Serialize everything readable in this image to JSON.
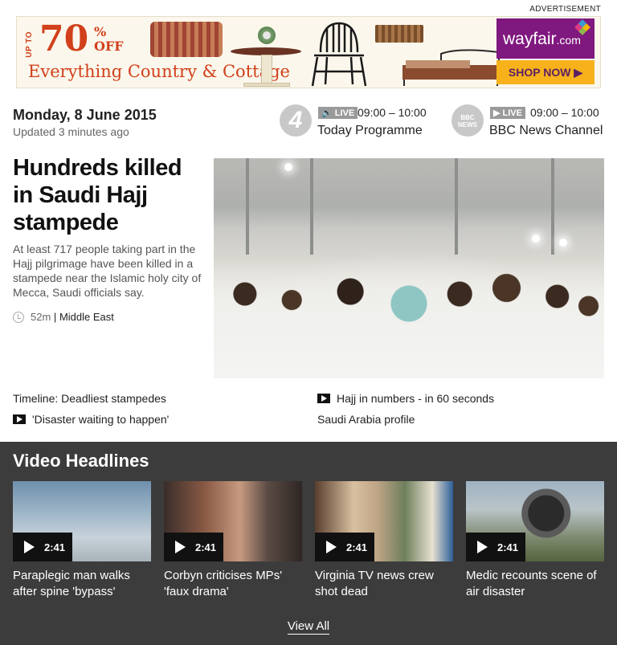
{
  "advertisement": {
    "label": "ADVERTISEMENT",
    "up_to": "UP TO",
    "percent": "70",
    "pct_sign": "%",
    "off": "OFF",
    "tagline": "Everything Country & Cottage",
    "brand": "wayfair",
    "brand_suffix": ".com",
    "cta": "SHOP NOW ▶"
  },
  "header": {
    "date": "Monday, 8 June 2015",
    "updated": "Updated 3 minutes ago"
  },
  "programmes": [
    {
      "logo": "4",
      "live": "LIVE",
      "time": "09:00 – 10:00",
      "name": "Today Programme",
      "icon": "speaker-icon"
    },
    {
      "logo": "BBC NEWS",
      "live": "LIVE",
      "time": "09:00 – 10:00",
      "name": "BBC News Channel",
      "icon": "play-icon"
    }
  ],
  "lead": {
    "headline": "Hundreds killed in Saudi Hajj stampede",
    "summary": "At least 717 people taking part in the Hajj pilgrimage have been killed in a stampede near the Islamic holy city of Mecca, Saudi officials say.",
    "age": "52m",
    "separator": "|",
    "section": "Middle East"
  },
  "related": [
    {
      "label": "Timeline: Deadliest stampedes",
      "video": false
    },
    {
      "label": "Hajj in numbers - in 60 seconds",
      "video": true
    },
    {
      "label": "'Disaster waiting to happen'",
      "video": true
    },
    {
      "label": "Saudi Arabia profile",
      "video": false
    }
  ],
  "video_headlines": {
    "title": "Video Headlines",
    "items": [
      {
        "duration": "2:41",
        "caption": "Paraplegic man walks after spine 'bypass'"
      },
      {
        "duration": "2:41",
        "caption": "Corbyn criticises MPs' 'faux drama'"
      },
      {
        "duration": "2:41",
        "caption": "Virginia TV news crew shot dead"
      },
      {
        "duration": "2:41",
        "caption": "Medic recounts scene of air disaster"
      }
    ],
    "view_all": "View All"
  },
  "colors": {
    "ad_accent": "#d1401a",
    "wayfair_purple": "#7f187f",
    "shop_button": "#f7b21b",
    "video_bg": "#3c3c3c",
    "live_badge": "#9a9a9a"
  }
}
